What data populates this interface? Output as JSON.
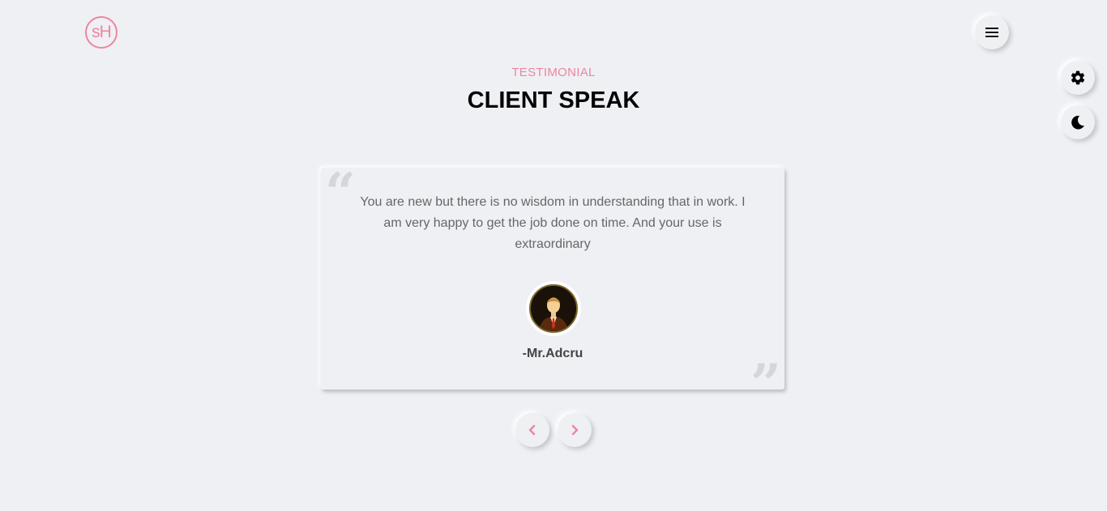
{
  "header": {
    "logo_text": "sH"
  },
  "section": {
    "kicker": "TESTIMONIAL",
    "title": "CLIENT SPEAK"
  },
  "testimonial": {
    "text": "You are new but there is no wisdom in understanding that in work. I am very happy to get the job done on time. And your use is extraordinary",
    "client_name": "-Mr.Adcru"
  },
  "icons": {
    "menu": "hamburger-menu-icon",
    "settings": "gear-icon",
    "theme": "moon-icon",
    "prev": "chevron-left-icon",
    "next": "chevron-right-icon"
  },
  "colors": {
    "accent": "#ec86a0",
    "background": "#eff0f4",
    "text_muted": "#666666"
  }
}
